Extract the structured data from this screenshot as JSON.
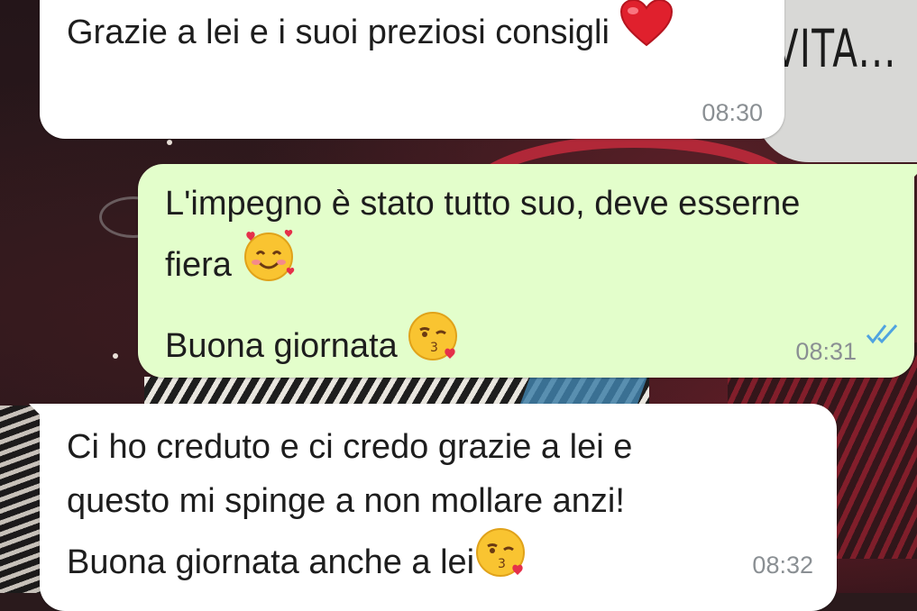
{
  "messages": [
    {
      "direction": "incoming",
      "lines": [
        "Grazie a lei e i suoi preziosi consigli"
      ],
      "emoji": "red-heart",
      "time": "08:30"
    },
    {
      "direction": "outgoing",
      "lines": [
        "L'impegno è stato tutto suo, deve esserne",
        "fiera",
        "Buona giornata"
      ],
      "emojis": [
        "smiling-face-with-hearts",
        "face-blowing-a-kiss"
      ],
      "time": "08:31",
      "status": "read-double-check"
    },
    {
      "direction": "incoming",
      "lines": [
        "Ci ho creduto e ci credo grazie a lei e",
        "questo mi spinge a non mollare anzi!",
        "Buona giornata anche a lei"
      ],
      "emoji": "face-blowing-a-kiss",
      "time": "08:32"
    }
  ],
  "colors": {
    "incoming_bubble": "#ffffff",
    "outgoing_bubble": "#e3fecb",
    "read_ticks": "#4fa3e0",
    "timestamp": "#8a8f93"
  }
}
